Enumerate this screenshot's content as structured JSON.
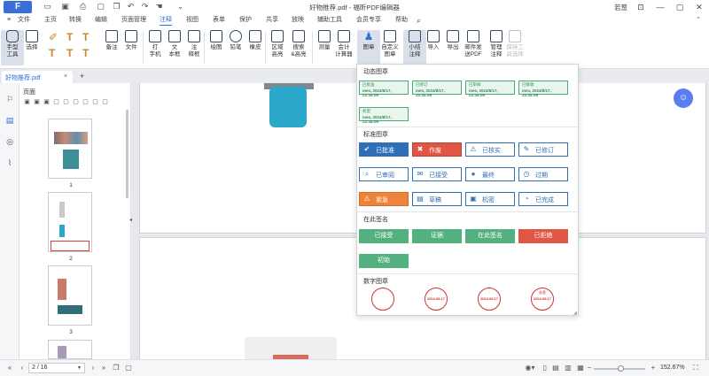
{
  "app": {
    "logo": "F",
    "window_title": "好物推荐.pdf - 福昕PDF编辑器",
    "user": "若葱",
    "win_controls": [
      "—",
      "▢",
      "✕"
    ]
  },
  "menu": [
    {
      "label": "文件"
    },
    {
      "label": "主页"
    },
    {
      "label": "转换"
    },
    {
      "label": "编辑"
    },
    {
      "label": "页面管理"
    },
    {
      "label": "注释",
      "active": true
    },
    {
      "label": "视图"
    },
    {
      "label": "表单"
    },
    {
      "label": "保护"
    },
    {
      "label": "共享"
    },
    {
      "label": "放映"
    },
    {
      "label": "辅助工具"
    },
    {
      "label": "会员专享"
    },
    {
      "label": "帮助"
    }
  ],
  "ribbon": {
    "hand": "手型\n工具",
    "select": "选择",
    "note": "备注",
    "file": "文件",
    "typewriter": "打\n字机",
    "textbox": "文\n本框",
    "callout": "注\n释框",
    "drawing": "绘图",
    "pencil": "铅笔",
    "eraser": "橡皮",
    "area_highlight": "区域\n高亮",
    "search_highlight": "搜索\n&高亮",
    "measure": "测量",
    "calculator": "会计\n计算器",
    "stamp": "图章",
    "custom_stamp": "自定义\n图章",
    "summarize": "小结\n注释",
    "import": "导入",
    "export": "导出",
    "email_pdf": "邮件发\n送PDF",
    "manage": "管理\n注释",
    "keep_tool": "保持工\n具选择"
  },
  "tab": {
    "name": "好物推荐.pdf",
    "close": "×",
    "add": "+"
  },
  "panel": {
    "title": "页面",
    "pages": [
      "1",
      "2",
      "3"
    ]
  },
  "dropdown": {
    "dynamic_title": "动态图章",
    "dynamic": [
      {
        "label": "已批准",
        "date": "mes, 2024/8/17, 22:34:09"
      },
      {
        "label": "已修订",
        "date": "mes, 2024/8/17, 22:34:09"
      },
      {
        "label": "已审阅",
        "date": "mes, 2024/8/17, 22:34:09"
      },
      {
        "label": "已接收",
        "date": "mes, 2024/8/17, 22:34:09"
      },
      {
        "label": "机密",
        "date": "mes, 2024/8/17, 22:34:09"
      }
    ],
    "standard_title": "标准图章",
    "standard": [
      {
        "label": "已批准",
        "icon": "check-icon",
        "glyph": "✔",
        "style": "fill-blue"
      },
      {
        "label": "作废",
        "icon": "x-icon",
        "glyph": "✖",
        "style": "fill-red"
      },
      {
        "label": "已核实",
        "icon": "warning-icon",
        "glyph": "⚠",
        "style": ""
      },
      {
        "label": "已修订",
        "icon": "pen-icon",
        "glyph": "✎",
        "style": ""
      },
      {
        "label": "已审阅",
        "icon": "magnifier-icon",
        "glyph": "⌕",
        "style": ""
      },
      {
        "label": "已接受",
        "icon": "mail-icon",
        "glyph": "✉",
        "style": ""
      },
      {
        "label": "最终",
        "icon": "person-icon",
        "glyph": "●",
        "style": ""
      },
      {
        "label": "过期",
        "icon": "clock-icon",
        "glyph": "◷",
        "style": ""
      },
      {
        "label": "紧急",
        "icon": "alert-icon",
        "glyph": "⚠",
        "style": "fill-orange"
      },
      {
        "label": "草稿",
        "icon": "doc-icon",
        "glyph": "▤",
        "style": ""
      },
      {
        "label": "机密",
        "icon": "lock-icon",
        "glyph": "▣",
        "style": ""
      },
      {
        "label": "已完成",
        "icon": "complete-icon",
        "glyph": "◔",
        "style": ""
      }
    ],
    "sign_title": "在此签名",
    "sign": [
      {
        "label": "已接受",
        "style": ""
      },
      {
        "label": "证据",
        "style": ""
      },
      {
        "label": "在此签名",
        "style": ""
      },
      {
        "label": "已拒绝",
        "style": "red"
      },
      {
        "label": "初始",
        "style": ""
      }
    ],
    "digital_title": "数字图章",
    "digital": [
      {
        "top": "",
        "date": ""
      },
      {
        "top": "",
        "date": "2024.08.17"
      },
      {
        "top": "",
        "date": "2024.08.17"
      },
      {
        "top": "若葱",
        "date": "2024.08.17"
      }
    ]
  },
  "status": {
    "page_indicator": "2 / 16",
    "zoom": "152.67%"
  },
  "colors": {
    "accent": "#2f6fd6",
    "stamp_blue": "#2f6fb8",
    "stamp_green": "#53b07f",
    "stamp_red": "#e15544"
  }
}
